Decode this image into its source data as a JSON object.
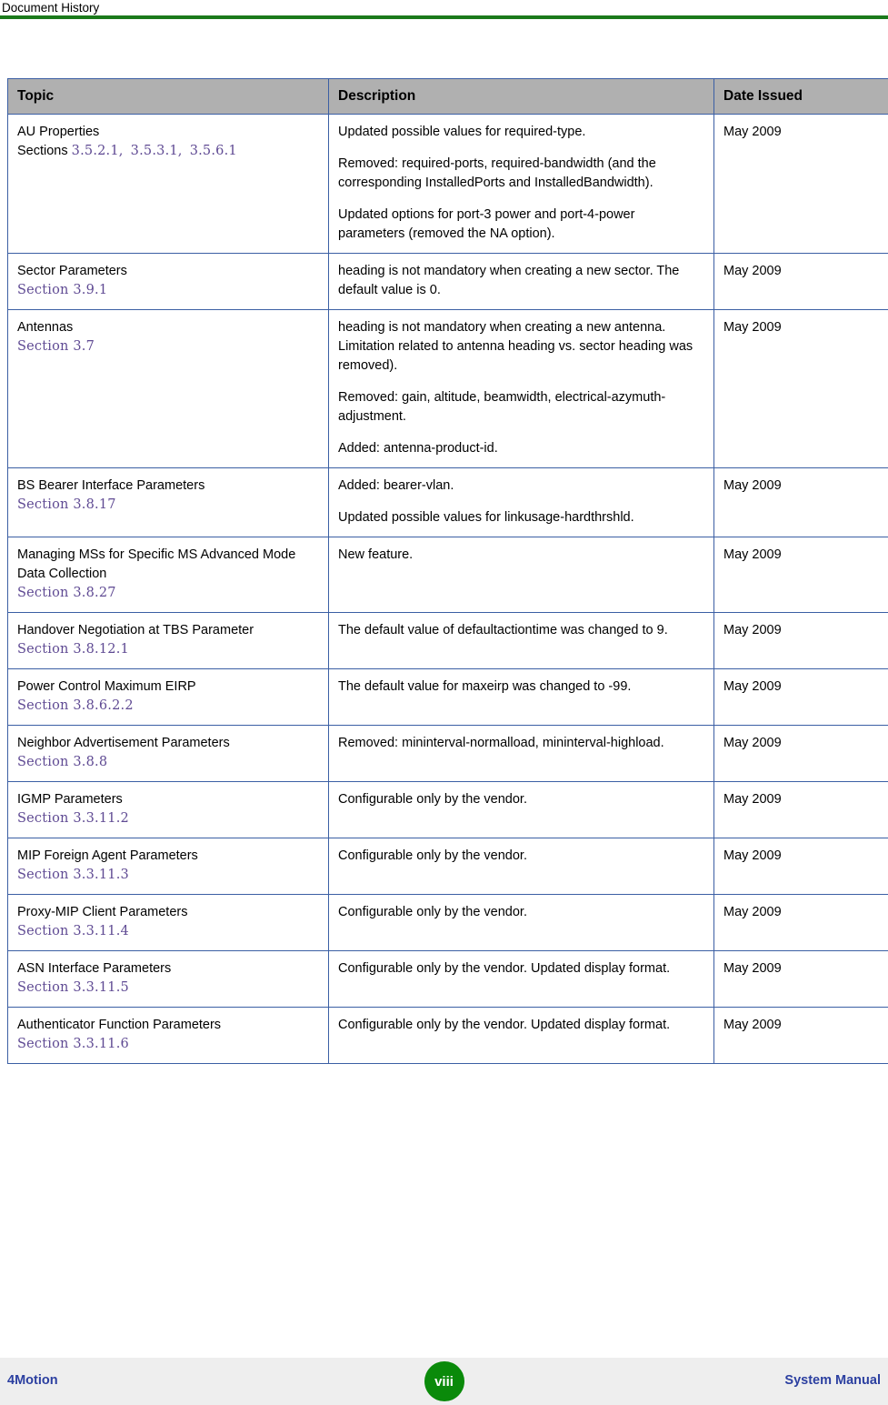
{
  "header": {
    "title": "Document History",
    "rule_color": "#1b7a1b"
  },
  "table": {
    "columns": [
      "Topic",
      "Description",
      "Date Issued"
    ],
    "rows": [
      {
        "topic_title": "AU Properties",
        "topic_prefix": "Sections ",
        "topic_sections": [
          "3.5.2.1,",
          "3.5.3.1,",
          "3.5.6.1"
        ],
        "description": [
          "Updated possible values for required-type.",
          "Removed: required-ports, required-bandwidth (and the corresponding InstalledPorts and InstalledBandwidth).",
          "Updated options for port-3 power and port-4-power parameters (removed the NA option)."
        ],
        "date": "May 2009"
      },
      {
        "topic_title": "Sector Parameters",
        "topic_prefix": "",
        "topic_sections": [
          "Section 3.9.1"
        ],
        "description": [
          "heading is not mandatory when creating a new sector. The default value is 0."
        ],
        "date": "May 2009"
      },
      {
        "topic_title": "Antennas",
        "topic_prefix": "",
        "topic_sections": [
          "Section 3.7"
        ],
        "description": [
          "heading is not mandatory when creating a new antenna. Limitation related to antenna heading vs. sector heading was removed).",
          "Removed: gain, altitude, beamwidth, electrical-azymuth-adjustment.",
          "Added: antenna-product-id."
        ],
        "date": "May 2009"
      },
      {
        "topic_title": "BS Bearer Interface Parameters",
        "topic_prefix": "",
        "topic_sections": [
          "Section 3.8.17"
        ],
        "description": [
          "Added: bearer-vlan.",
          "Updated possible values for linkusage-hardthrshld."
        ],
        "date": "May 2009"
      },
      {
        "topic_title": "Managing MSs for Specific MS Advanced Mode Data Collection",
        "topic_prefix": "",
        "topic_sections": [
          "Section 3.8.27"
        ],
        "description": [
          "New feature."
        ],
        "date": "May 2009"
      },
      {
        "topic_title": "Handover Negotiation at TBS Parameter",
        "topic_prefix": "",
        "topic_sections": [
          "Section 3.8.12.1"
        ],
        "description": [
          "The default value of defaultactiontime was changed to 9."
        ],
        "date": "May 2009"
      },
      {
        "topic_title": "Power Control Maximum EIRP",
        "topic_prefix": "",
        "topic_sections": [
          "Section 3.8.6.2.2"
        ],
        "description": [
          "The default value for maxeirp was changed to -99."
        ],
        "date": "May 2009"
      },
      {
        "topic_title": "Neighbor Advertisement Parameters",
        "topic_prefix": "",
        "topic_sections": [
          "Section 3.8.8"
        ],
        "description": [
          "Removed: mininterval-normalload, mininterval-highload."
        ],
        "date": "May 2009"
      },
      {
        "topic_title": "IGMP Parameters",
        "topic_prefix": "",
        "topic_sections": [
          "Section 3.3.11.2"
        ],
        "description": [
          "Configurable only by the vendor."
        ],
        "date": "May 2009"
      },
      {
        "topic_title": "MIP Foreign Agent Parameters",
        "topic_prefix": "",
        "topic_sections": [
          "Section 3.3.11.3"
        ],
        "description": [
          "Configurable only by the vendor."
        ],
        "date": "May 2009"
      },
      {
        "topic_title": "Proxy-MIP Client Parameters",
        "topic_prefix": "",
        "topic_sections": [
          "Section 3.3.11.4"
        ],
        "description": [
          "Configurable only by the vendor."
        ],
        "date": "May 2009"
      },
      {
        "topic_title": "ASN Interface Parameters",
        "topic_prefix": "",
        "topic_sections": [
          "Section 3.3.11.5"
        ],
        "description": [
          "Configurable only by the vendor. Updated display format."
        ],
        "date": "May 2009"
      },
      {
        "topic_title": "Authenticator Function Parameters",
        "topic_prefix": "",
        "topic_sections": [
          "Section 3.3.11.6"
        ],
        "description": [
          "Configurable only by the vendor. Updated display format."
        ],
        "date": "May 2009"
      }
    ]
  },
  "footer": {
    "left": "4Motion",
    "page_number": "viii",
    "right": "System Manual",
    "badge_color": "#0a8a0a",
    "link_color": "#2b3fa0"
  }
}
